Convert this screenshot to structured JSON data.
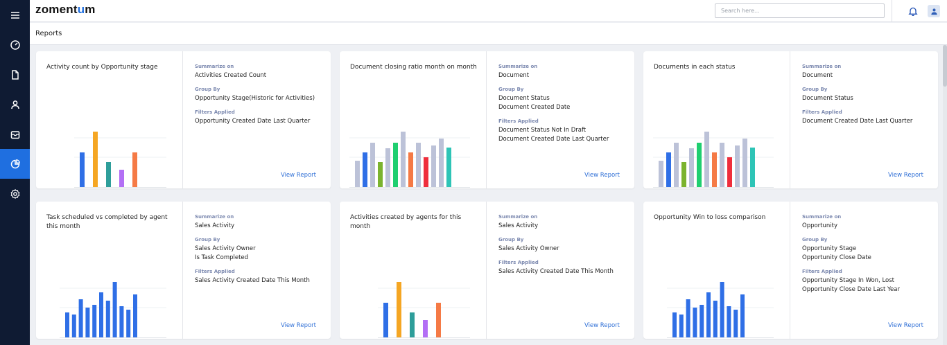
{
  "app": {
    "logo_text": "zoment",
    "logo_accent": "u",
    "logo_tail": "m",
    "search_placeholder": "Search here..."
  },
  "sidebar": {
    "items": [
      {
        "name": "menu-icon"
      },
      {
        "name": "dashboard-icon"
      },
      {
        "name": "document-icon"
      },
      {
        "name": "contact-icon"
      },
      {
        "name": "inbox-icon"
      },
      {
        "name": "reports-icon",
        "active": true
      },
      {
        "name": "settings-icon"
      }
    ]
  },
  "page": {
    "title": "Reports"
  },
  "labels": {
    "summarize": "Summarize on",
    "group": "Group By",
    "filters": "Filters Applied",
    "view": "View Report"
  },
  "colors": {
    "accent": "#1f6fe0",
    "sidebar": "#0f1b33",
    "blue": "#2f6fe6",
    "orange": "#f5a623",
    "teal": "#2e9e9a",
    "purple": "#b36ff5",
    "coral": "#f57a45",
    "gray": "#bcc2d8",
    "green": "#7bb32e",
    "brightgreen": "#1fcf70",
    "red": "#ef2e3c",
    "cyan": "#2ec4b6"
  },
  "cards": [
    {
      "title": "Activity count by Opportunity stage",
      "summarize": [
        "Activities Created Count"
      ],
      "group": [
        "Opportunity Stage(Historic for Activities)"
      ],
      "filters": [
        "Opportunity Created Date Last Quarter"
      ]
    },
    {
      "title": "Document closing ratio month on month",
      "summarize": [
        "Document"
      ],
      "group": [
        "Document Status",
        "Document Created Date"
      ],
      "filters": [
        "Document Status Not In Draft",
        "Document Created Date Last Quarter"
      ]
    },
    {
      "title": "Documents in each status",
      "summarize": [
        "Document"
      ],
      "group": [
        "Document Status"
      ],
      "filters": [
        "Document Created Date Last Quarter"
      ]
    },
    {
      "title": "Task scheduled vs completed by agent this month",
      "summarize": [
        "Sales Activity"
      ],
      "group": [
        "Sales Activity Owner",
        "Is Task Completed"
      ],
      "filters": [
        "Sales Activity Created Date This Month"
      ]
    },
    {
      "title": "Activities created by agents for this month",
      "summarize": [
        "Sales Activity"
      ],
      "group": [
        "Sales Activity Owner"
      ],
      "filters": [
        "Sales Activity Created Date This Month"
      ]
    },
    {
      "title": "Opportunity Win to loss comparison",
      "summarize": [
        "Opportunity"
      ],
      "group": [
        "Opportunity Stage",
        "Opportunity Close Date"
      ],
      "filters": [
        "Opportunity Stage In Won, Lost",
        "Opportunity Close Date Last Year"
      ]
    }
  ],
  "chart_data": [
    {
      "type": "bar",
      "values": [
        50,
        80,
        36,
        25,
        50
      ],
      "colors": [
        "blue",
        "orange",
        "teal",
        "purple",
        "coral"
      ]
    },
    {
      "type": "bar",
      "values": [
        38,
        50,
        64,
        36,
        56,
        64,
        80,
        50,
        64,
        43,
        60,
        70,
        57
      ],
      "colors": [
        "gray",
        "blue",
        "gray",
        "green",
        "gray",
        "brightgreen",
        "gray",
        "coral",
        "gray",
        "red",
        "gray",
        "gray",
        "cyan"
      ]
    },
    {
      "type": "bar",
      "values": [
        38,
        50,
        64,
        36,
        56,
        64,
        80,
        50,
        64,
        43,
        60,
        70,
        57
      ],
      "colors": [
        "gray",
        "blue",
        "gray",
        "green",
        "gray",
        "brightgreen",
        "gray",
        "coral",
        "gray",
        "red",
        "gray",
        "gray",
        "cyan"
      ]
    },
    {
      "type": "bar",
      "values": [
        36,
        33,
        55,
        43,
        47,
        65,
        53,
        80,
        45,
        40,
        62
      ],
      "colors": [
        "blue",
        "blue",
        "blue",
        "blue",
        "blue",
        "blue",
        "blue",
        "blue",
        "blue",
        "blue",
        "blue"
      ]
    },
    {
      "type": "bar",
      "values": [
        50,
        80,
        36,
        25,
        50
      ],
      "colors": [
        "blue",
        "orange",
        "teal",
        "purple",
        "coral"
      ]
    },
    {
      "type": "bar",
      "values": [
        36,
        33,
        55,
        43,
        47,
        65,
        53,
        80,
        45,
        40,
        62
      ],
      "colors": [
        "blue",
        "blue",
        "blue",
        "blue",
        "blue",
        "blue",
        "blue",
        "blue",
        "blue",
        "blue",
        "blue"
      ]
    }
  ]
}
